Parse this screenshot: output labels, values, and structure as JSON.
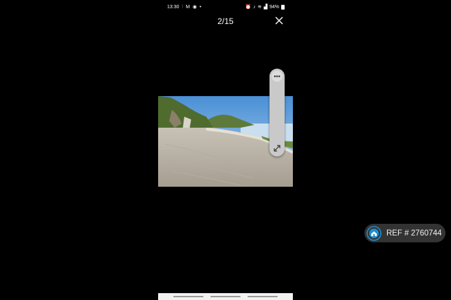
{
  "status_bar": {
    "time": "13:30",
    "battery": "94%",
    "left_icons": [
      "notification-icon",
      "gmail-icon",
      "messenger-icon",
      "dot-icon"
    ],
    "right_icons": [
      "alarm-icon",
      "mute-icon",
      "wifi-icon",
      "signal-icon"
    ]
  },
  "viewer": {
    "counter": "2/15",
    "close_icon": "close-icon",
    "more_icon": "more-icon",
    "expand_icon": "expand-icon"
  },
  "badge": {
    "ref_text": "REF # 2760744",
    "logo_icon": "home-logo-icon",
    "logo_color": "#1f8fd0"
  },
  "colors": {
    "background": "#000000",
    "pill": "#c9c9c9",
    "badge_bg": "#3c3c3c"
  }
}
